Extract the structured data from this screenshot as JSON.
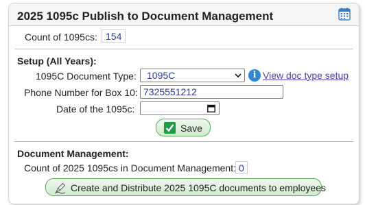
{
  "header": {
    "title": "2025 1095c Publish to Document Management",
    "icon": "calendar-icon"
  },
  "count_section": {
    "label": "Count of 1095cs:",
    "value": "154"
  },
  "setup": {
    "heading": "Setup (All Years):",
    "doc_type_label": "1095C Document Type:",
    "doc_type_value": "1095C",
    "view_link": "View doc type setup",
    "phone_label": "Phone Number for Box 10:",
    "phone_value": "7325551212",
    "date_label": "Date of the 1095c:",
    "date_value": "",
    "save_label": "Save"
  },
  "doc_mgmt": {
    "heading": "Document Management:",
    "count_label": "Count of 2025 1095cs in Document Management:",
    "count_value": "0",
    "create_label": "Create and Distribute 2025 1095C documents to employees"
  },
  "colors": {
    "accent_green": "#1f9a45",
    "link_purple": "#5a3aa8",
    "value_blue": "#2a3a9a",
    "info_blue": "#2f86d6"
  }
}
